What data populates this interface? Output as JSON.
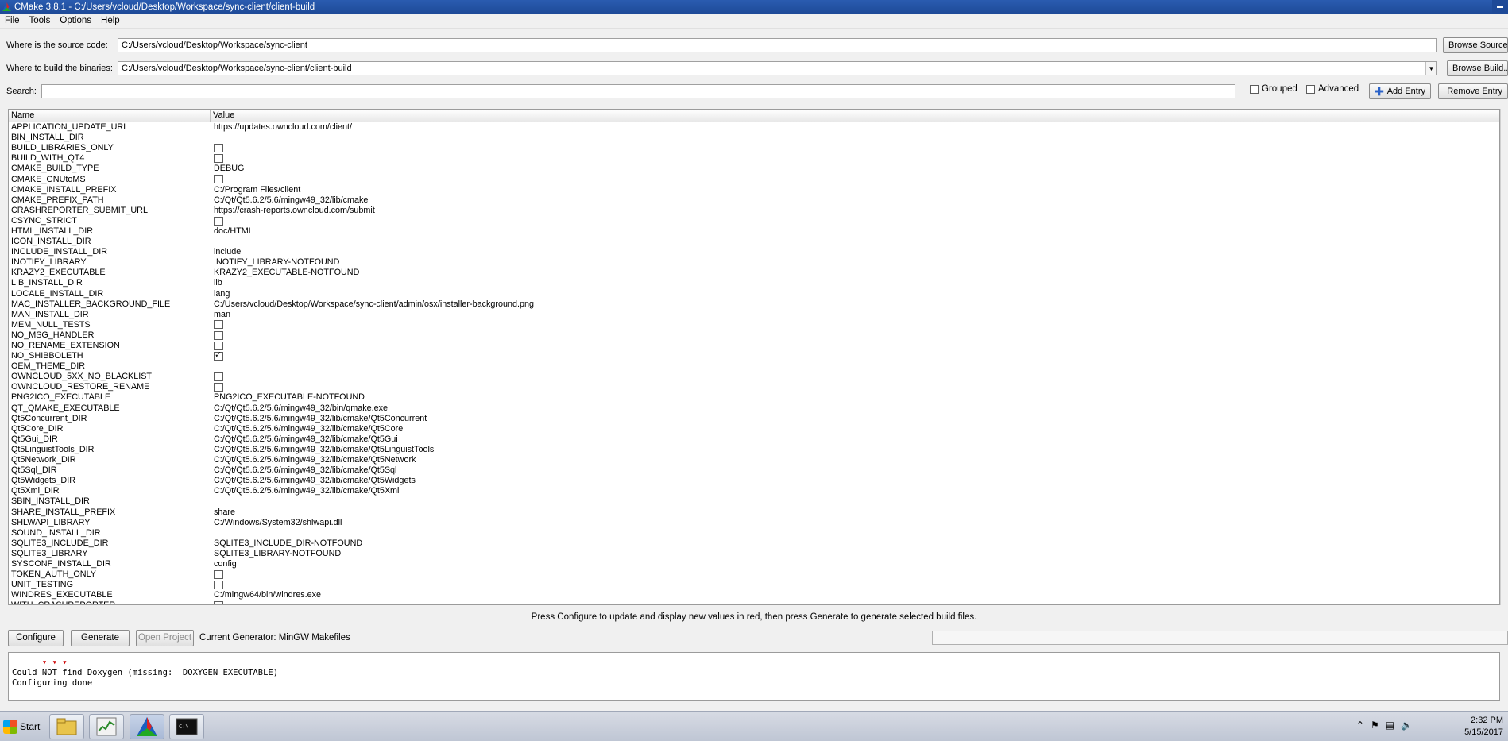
{
  "window": {
    "title": "CMake 3.8.1 - C:/Users/vcloud/Desktop/Workspace/sync-client/client-build"
  },
  "menu": [
    "File",
    "Tools",
    "Options",
    "Help"
  ],
  "source": {
    "label": "Where is the source code:",
    "value": "C:/Users/vcloud/Desktop/Workspace/sync-client",
    "button": "Browse Source..."
  },
  "build": {
    "label": "Where to build the binaries:",
    "value": "C:/Users/vcloud/Desktop/Workspace/sync-client/client-build",
    "button": "Browse Build..."
  },
  "search": {
    "label": "Search:",
    "value": "",
    "grouped_label": "Grouped",
    "grouped_checked": false,
    "advanced_label": "Advanced",
    "advanced_checked": false,
    "add_entry": "Add Entry",
    "remove_entry": "Remove Entry"
  },
  "table": {
    "headers": [
      "Name",
      "Value"
    ],
    "rows": [
      {
        "name": "APPLICATION_UPDATE_URL",
        "type": "text",
        "value": "https://updates.owncloud.com/client/"
      },
      {
        "name": "BIN_INSTALL_DIR",
        "type": "text",
        "value": "."
      },
      {
        "name": "BUILD_LIBRARIES_ONLY",
        "type": "bool",
        "value": false
      },
      {
        "name": "BUILD_WITH_QT4",
        "type": "bool",
        "value": false
      },
      {
        "name": "CMAKE_BUILD_TYPE",
        "type": "text",
        "value": "DEBUG"
      },
      {
        "name": "CMAKE_GNUtoMS",
        "type": "bool",
        "value": false
      },
      {
        "name": "CMAKE_INSTALL_PREFIX",
        "type": "text",
        "value": "C:/Program Files/client"
      },
      {
        "name": "CMAKE_PREFIX_PATH",
        "type": "text",
        "value": "C:/Qt/Qt5.6.2/5.6/mingw49_32/lib/cmake"
      },
      {
        "name": "CRASHREPORTER_SUBMIT_URL",
        "type": "text",
        "value": "https://crash-reports.owncloud.com/submit"
      },
      {
        "name": "CSYNC_STRICT",
        "type": "bool",
        "value": false
      },
      {
        "name": "HTML_INSTALL_DIR",
        "type": "text",
        "value": "doc/HTML"
      },
      {
        "name": "ICON_INSTALL_DIR",
        "type": "text",
        "value": "."
      },
      {
        "name": "INCLUDE_INSTALL_DIR",
        "type": "text",
        "value": "include"
      },
      {
        "name": "INOTIFY_LIBRARY",
        "type": "text",
        "value": "INOTIFY_LIBRARY-NOTFOUND"
      },
      {
        "name": "KRAZY2_EXECUTABLE",
        "type": "text",
        "value": "KRAZY2_EXECUTABLE-NOTFOUND"
      },
      {
        "name": "LIB_INSTALL_DIR",
        "type": "text",
        "value": "lib"
      },
      {
        "name": "LOCALE_INSTALL_DIR",
        "type": "text",
        "value": "lang"
      },
      {
        "name": "MAC_INSTALLER_BACKGROUND_FILE",
        "type": "text",
        "value": "C:/Users/vcloud/Desktop/Workspace/sync-client/admin/osx/installer-background.png"
      },
      {
        "name": "MAN_INSTALL_DIR",
        "type": "text",
        "value": "man"
      },
      {
        "name": "MEM_NULL_TESTS",
        "type": "bool",
        "value": false
      },
      {
        "name": "NO_MSG_HANDLER",
        "type": "bool",
        "value": false
      },
      {
        "name": "NO_RENAME_EXTENSION",
        "type": "bool",
        "value": false
      },
      {
        "name": "NO_SHIBBOLETH",
        "type": "bool",
        "value": true
      },
      {
        "name": "OEM_THEME_DIR",
        "type": "text",
        "value": ""
      },
      {
        "name": "OWNCLOUD_5XX_NO_BLACKLIST",
        "type": "bool",
        "value": false
      },
      {
        "name": "OWNCLOUD_RESTORE_RENAME",
        "type": "bool",
        "value": false
      },
      {
        "name": "PNG2ICO_EXECUTABLE",
        "type": "text",
        "value": "PNG2ICO_EXECUTABLE-NOTFOUND"
      },
      {
        "name": "QT_QMAKE_EXECUTABLE",
        "type": "text",
        "value": "C:/Qt/Qt5.6.2/5.6/mingw49_32/bin/qmake.exe"
      },
      {
        "name": "Qt5Concurrent_DIR",
        "type": "text",
        "value": "C:/Qt/Qt5.6.2/5.6/mingw49_32/lib/cmake/Qt5Concurrent"
      },
      {
        "name": "Qt5Core_DIR",
        "type": "text",
        "value": "C:/Qt/Qt5.6.2/5.6/mingw49_32/lib/cmake/Qt5Core"
      },
      {
        "name": "Qt5Gui_DIR",
        "type": "text",
        "value": "C:/Qt/Qt5.6.2/5.6/mingw49_32/lib/cmake/Qt5Gui"
      },
      {
        "name": "Qt5LinguistTools_DIR",
        "type": "text",
        "value": "C:/Qt/Qt5.6.2/5.6/mingw49_32/lib/cmake/Qt5LinguistTools"
      },
      {
        "name": "Qt5Network_DIR",
        "type": "text",
        "value": "C:/Qt/Qt5.6.2/5.6/mingw49_32/lib/cmake/Qt5Network"
      },
      {
        "name": "Qt5Sql_DIR",
        "type": "text",
        "value": "C:/Qt/Qt5.6.2/5.6/mingw49_32/lib/cmake/Qt5Sql"
      },
      {
        "name": "Qt5Widgets_DIR",
        "type": "text",
        "value": "C:/Qt/Qt5.6.2/5.6/mingw49_32/lib/cmake/Qt5Widgets"
      },
      {
        "name": "Qt5Xml_DIR",
        "type": "text",
        "value": "C:/Qt/Qt5.6.2/5.6/mingw49_32/lib/cmake/Qt5Xml"
      },
      {
        "name": "SBIN_INSTALL_DIR",
        "type": "text",
        "value": "."
      },
      {
        "name": "SHARE_INSTALL_PREFIX",
        "type": "text",
        "value": "share"
      },
      {
        "name": "SHLWAPI_LIBRARY",
        "type": "text",
        "value": "C:/Windows/System32/shlwapi.dll"
      },
      {
        "name": "SOUND_INSTALL_DIR",
        "type": "text",
        "value": "."
      },
      {
        "name": "SQLITE3_INCLUDE_DIR",
        "type": "text",
        "value": "SQLITE3_INCLUDE_DIR-NOTFOUND"
      },
      {
        "name": "SQLITE3_LIBRARY",
        "type": "text",
        "value": "SQLITE3_LIBRARY-NOTFOUND"
      },
      {
        "name": "SYSCONF_INSTALL_DIR",
        "type": "text",
        "value": "config"
      },
      {
        "name": "TOKEN_AUTH_ONLY",
        "type": "bool",
        "value": false
      },
      {
        "name": "UNIT_TESTING",
        "type": "bool",
        "value": false
      },
      {
        "name": "WINDRES_EXECUTABLE",
        "type": "text",
        "value": "C:/mingw64/bin/windres.exe"
      },
      {
        "name": "WITH_CRASHREPORTER",
        "type": "bool",
        "value": false
      }
    ]
  },
  "hint": "Press Configure to update and display new values in red, then press Generate to generate selected build files.",
  "actions": {
    "configure": "Configure",
    "generate": "Generate",
    "open_project": "Open Project",
    "generator": "Current Generator: MinGW Makefiles"
  },
  "output": {
    "lines": [
      "Could NOT find Doxygen (missing:  DOXYGEN_EXECUTABLE)",
      "Configuring done"
    ]
  },
  "taskbar": {
    "start": "Start",
    "time": "2:32 PM",
    "date": "5/15/2017"
  }
}
